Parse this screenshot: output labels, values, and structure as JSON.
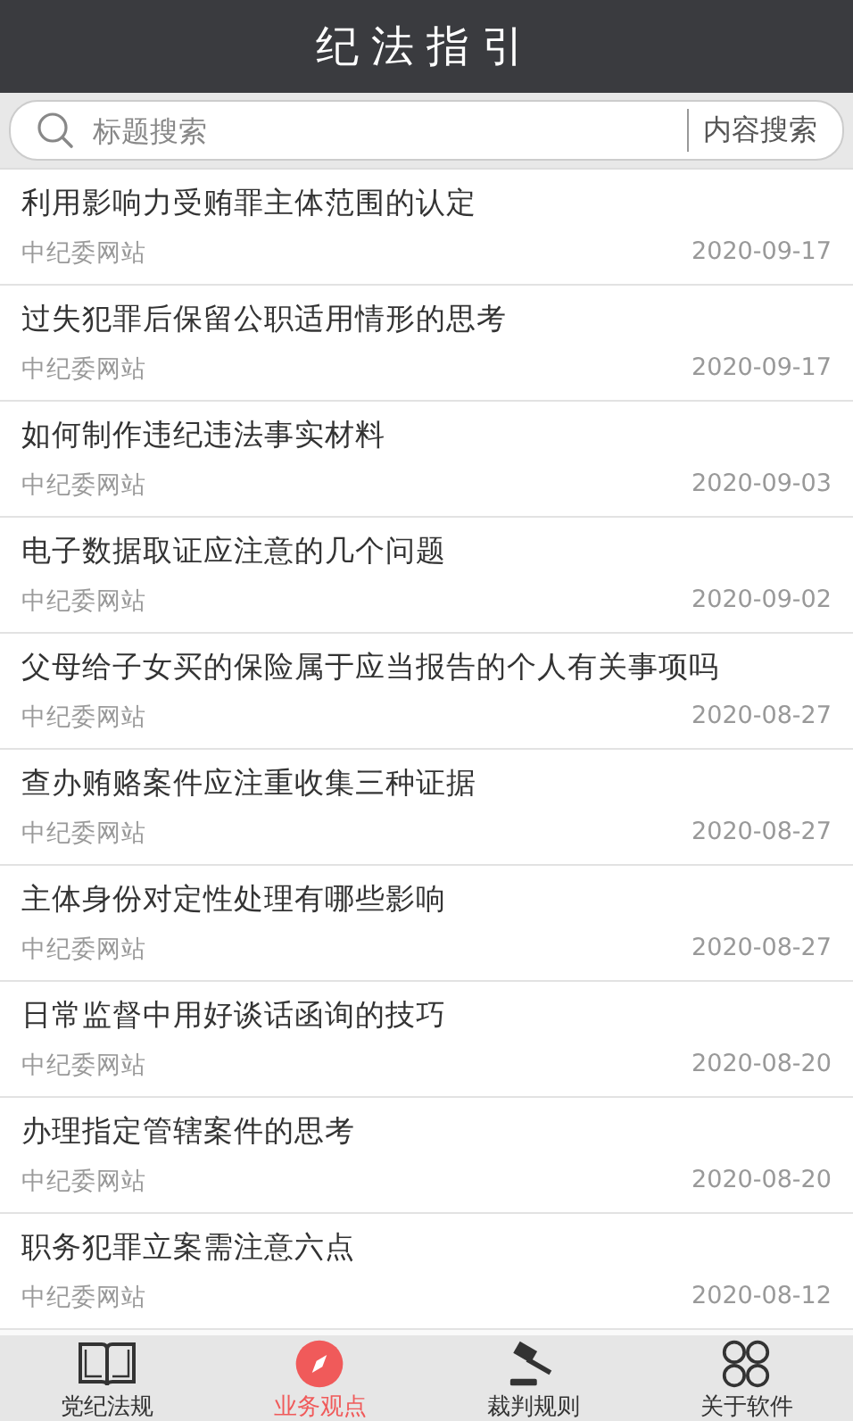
{
  "header": {
    "title": "纪法指引"
  },
  "search": {
    "placeholder": "标题搜索",
    "button": "内容搜索"
  },
  "articles": [
    {
      "title": "利用影响力受贿罪主体范围的认定",
      "source": "中纪委网站",
      "date": "2020-09-17"
    },
    {
      "title": "过失犯罪后保留公职适用情形的思考",
      "source": "中纪委网站",
      "date": "2020-09-17"
    },
    {
      "title": "如何制作违纪违法事实材料",
      "source": "中纪委网站",
      "date": "2020-09-03"
    },
    {
      "title": "电子数据取证应注意的几个问题",
      "source": "中纪委网站",
      "date": "2020-09-02"
    },
    {
      "title": "父母给子女买的保险属于应当报告的个人有关事项吗",
      "source": "中纪委网站",
      "date": "2020-08-27"
    },
    {
      "title": "查办贿赂案件应注重收集三种证据",
      "source": "中纪委网站",
      "date": "2020-08-27"
    },
    {
      "title": "主体身份对定性处理有哪些影响",
      "source": "中纪委网站",
      "date": "2020-08-27"
    },
    {
      "title": "日常监督中用好谈话函询的技巧",
      "source": "中纪委网站",
      "date": "2020-08-20"
    },
    {
      "title": "办理指定管辖案件的思考",
      "source": "中纪委网站",
      "date": "2020-08-20"
    },
    {
      "title": "职务犯罪立案需注意六点",
      "source": "中纪委网站",
      "date": "2020-08-12"
    }
  ],
  "tabs": [
    {
      "label": "党纪法规",
      "kind": "book",
      "selected": false
    },
    {
      "label": "业务观点",
      "kind": "compass",
      "selected": true
    },
    {
      "label": "裁判规则",
      "kind": "gavel",
      "selected": false
    },
    {
      "label": "关于软件",
      "kind": "loops",
      "selected": false
    }
  ]
}
